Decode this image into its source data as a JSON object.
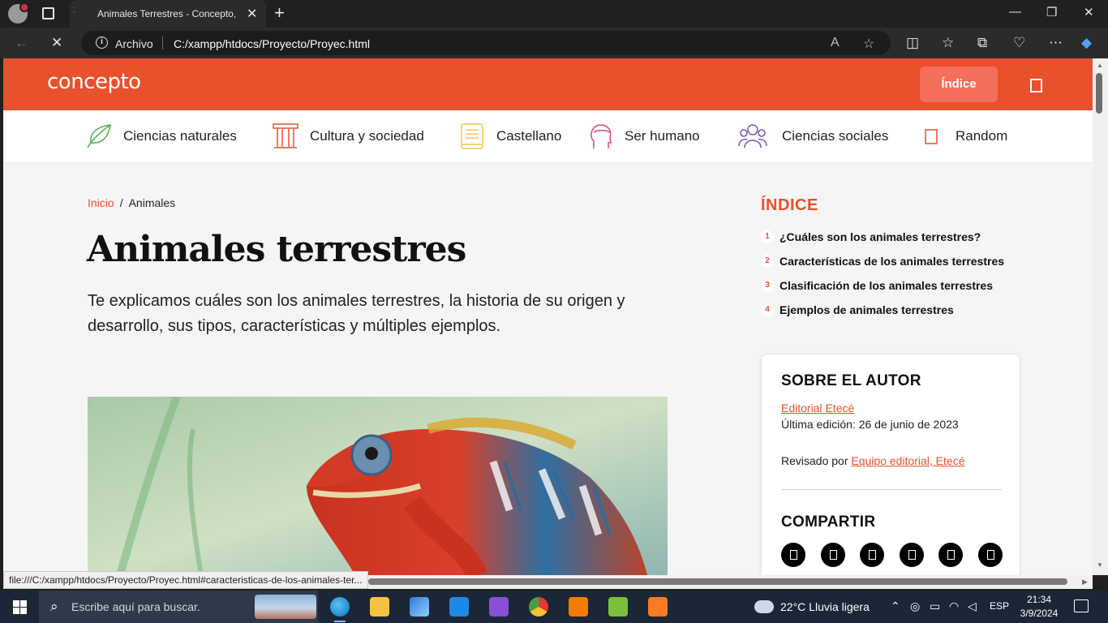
{
  "browser": {
    "tab_title": "Animales Terrestres - Concepto, ti",
    "address_label": "Archivo",
    "url": "C:/xampp/htdocs/Proyecto/Proyec.html",
    "status_url": "file:///C:/xampp/htdocs/Proyecto/Proyec.html#caracteristicas-de-los-animales-ter..."
  },
  "site": {
    "logo": "concepto",
    "indice_button": "Índice",
    "nav": [
      {
        "label": "Ciencias naturales",
        "icon": "leaf-icon",
        "color": "#4caf50"
      },
      {
        "label": "Cultura y sociedad",
        "icon": "column-icon",
        "color": "#e8512c"
      },
      {
        "label": "Castellano",
        "icon": "book-icon",
        "color": "#f2c94c"
      },
      {
        "label": "Ser humano",
        "icon": "head-icon",
        "color": "#e0457b"
      },
      {
        "label": "Ciencias sociales",
        "icon": "people-icon",
        "color": "#7b4fb8"
      },
      {
        "label": "Random",
        "icon": "random-icon",
        "color": "#e8512c"
      }
    ]
  },
  "article": {
    "breadcrumb_home": "Inicio",
    "breadcrumb_sep": "/",
    "breadcrumb_current": "Animales",
    "title": "Animales terrestres",
    "lead": "Te explicamos cuáles son los animales terrestres, la historia de su origen y desarrollo, sus tipos, características y múltiples ejemplos."
  },
  "toc": {
    "heading": "ÍNDICE",
    "items": [
      {
        "num": "1",
        "label": "¿Cuáles son los animales terrestres?"
      },
      {
        "num": "2",
        "label": "Características de los animales terrestres"
      },
      {
        "num": "3",
        "label": "Clasificación de los animales terrestres"
      },
      {
        "num": "4",
        "label": "Ejemplos de animales terrestres"
      }
    ]
  },
  "author": {
    "heading": "SOBRE EL AUTOR",
    "name": "Editorial Etecé",
    "edition": "Última edición: 26 de junio de 2023",
    "reviewed_prefix": "Revisado por",
    "reviewer": "Equipo editorial, Etecé",
    "share_heading": "COMPARTIR"
  },
  "taskbar": {
    "search_placeholder": "Escribe aquí para buscar.",
    "weather": "22°C  Lluvia ligera",
    "language": "ESP",
    "time": "21:34",
    "date": "3/9/2024"
  },
  "colors": {
    "brand": "#e8512c",
    "indice_button": "#f46e5b"
  }
}
